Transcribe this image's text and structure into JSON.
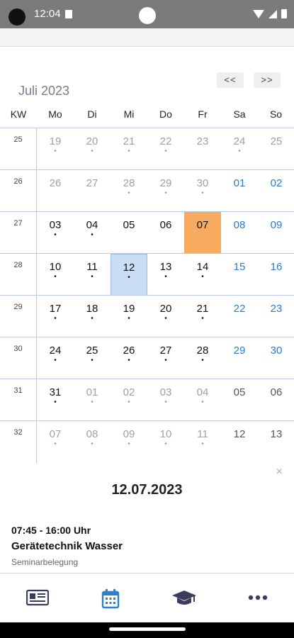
{
  "status": {
    "time": "12:04"
  },
  "calendar": {
    "prev_label": "<<",
    "next_label": ">>",
    "month": "Juli 2023",
    "headers": [
      "KW",
      "Mo",
      "Di",
      "Mi",
      "Do",
      "Fr",
      "Sa",
      "So"
    ],
    "weeks": [
      {
        "kw": "25",
        "days": [
          {
            "d": "19",
            "t": "other",
            "dot": true
          },
          {
            "d": "20",
            "t": "other",
            "dot": true
          },
          {
            "d": "21",
            "t": "other",
            "dot": true
          },
          {
            "d": "22",
            "t": "other",
            "dot": true
          },
          {
            "d": "23",
            "t": "other",
            "dot": false
          },
          {
            "d": "24",
            "t": "other",
            "dot": true
          },
          {
            "d": "25",
            "t": "other",
            "dot": false
          }
        ]
      },
      {
        "kw": "26",
        "days": [
          {
            "d": "26",
            "t": "other",
            "dot": false
          },
          {
            "d": "27",
            "t": "other",
            "dot": false
          },
          {
            "d": "28",
            "t": "other",
            "dot": true
          },
          {
            "d": "29",
            "t": "other",
            "dot": true
          },
          {
            "d": "30",
            "t": "other",
            "dot": true
          },
          {
            "d": "01",
            "t": "weekend",
            "dot": false
          },
          {
            "d": "02",
            "t": "weekend",
            "dot": false
          }
        ]
      },
      {
        "kw": "27",
        "days": [
          {
            "d": "03",
            "t": "cur",
            "dot": true
          },
          {
            "d": "04",
            "t": "cur",
            "dot": true
          },
          {
            "d": "05",
            "t": "cur",
            "dot": false
          },
          {
            "d": "06",
            "t": "cur",
            "dot": false
          },
          {
            "d": "07",
            "t": "cur",
            "dot": false,
            "state": "today"
          },
          {
            "d": "08",
            "t": "weekend",
            "dot": false
          },
          {
            "d": "09",
            "t": "weekend",
            "dot": false
          }
        ]
      },
      {
        "kw": "28",
        "days": [
          {
            "d": "10",
            "t": "cur",
            "dot": true
          },
          {
            "d": "11",
            "t": "cur",
            "dot": true
          },
          {
            "d": "12",
            "t": "cur",
            "dot": true,
            "state": "selected"
          },
          {
            "d": "13",
            "t": "cur",
            "dot": true
          },
          {
            "d": "14",
            "t": "cur",
            "dot": true
          },
          {
            "d": "15",
            "t": "weekend",
            "dot": false
          },
          {
            "d": "16",
            "t": "weekend",
            "dot": false
          }
        ]
      },
      {
        "kw": "29",
        "days": [
          {
            "d": "17",
            "t": "cur",
            "dot": true
          },
          {
            "d": "18",
            "t": "cur",
            "dot": true
          },
          {
            "d": "19",
            "t": "cur",
            "dot": true
          },
          {
            "d": "20",
            "t": "cur",
            "dot": true
          },
          {
            "d": "21",
            "t": "cur",
            "dot": true
          },
          {
            "d": "22",
            "t": "weekend",
            "dot": false
          },
          {
            "d": "23",
            "t": "weekend",
            "dot": false
          }
        ]
      },
      {
        "kw": "30",
        "days": [
          {
            "d": "24",
            "t": "cur",
            "dot": true
          },
          {
            "d": "25",
            "t": "cur",
            "dot": true
          },
          {
            "d": "26",
            "t": "cur",
            "dot": true
          },
          {
            "d": "27",
            "t": "cur",
            "dot": true
          },
          {
            "d": "28",
            "t": "cur",
            "dot": true
          },
          {
            "d": "29",
            "t": "weekend",
            "dot": false
          },
          {
            "d": "30",
            "t": "weekend",
            "dot": false
          }
        ]
      },
      {
        "kw": "31",
        "days": [
          {
            "d": "31",
            "t": "cur",
            "dot": true
          },
          {
            "d": "01",
            "t": "other",
            "dot": true
          },
          {
            "d": "02",
            "t": "other",
            "dot": true
          },
          {
            "d": "03",
            "t": "other",
            "dot": true
          },
          {
            "d": "04",
            "t": "other",
            "dot": true
          },
          {
            "d": "05",
            "t": "other weekend",
            "dot": false
          },
          {
            "d": "06",
            "t": "other weekend",
            "dot": false
          }
        ]
      },
      {
        "kw": "32",
        "days": [
          {
            "d": "07",
            "t": "other",
            "dot": true
          },
          {
            "d": "08",
            "t": "other",
            "dot": true
          },
          {
            "d": "09",
            "t": "other",
            "dot": true
          },
          {
            "d": "10",
            "t": "other",
            "dot": true
          },
          {
            "d": "11",
            "t": "other",
            "dot": true
          },
          {
            "d": "12",
            "t": "other weekend",
            "dot": false
          },
          {
            "d": "13",
            "t": "other weekend",
            "dot": false
          }
        ]
      }
    ]
  },
  "detail": {
    "close": "×",
    "date": "12.07.2023",
    "time": "07:45 - 16:00 Uhr",
    "title": "Gerätetechnik Wasser",
    "subtitle": "Seminarbelegung"
  },
  "bottom_nav": {
    "items": [
      "news-icon",
      "calendar-icon",
      "graduation-cap-icon",
      "more-icon"
    ],
    "active": "calendar-icon",
    "colors": {
      "active": "#2f7fc8",
      "inactive": "#3a3d5c"
    }
  },
  "colors": {
    "today": "#f8aa60",
    "selected": "#c9ddf5",
    "weekend": "#2d7bd0",
    "grid": "#b9c9e6"
  }
}
